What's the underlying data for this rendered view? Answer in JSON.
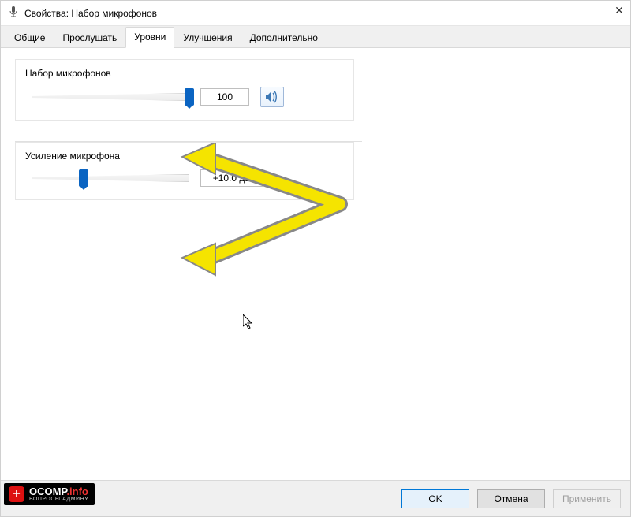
{
  "window": {
    "title": "Свойства: Набор микрофонов"
  },
  "tabs": {
    "general": "Общие",
    "listen": "Прослушать",
    "levels": "Уровни",
    "enhancements": "Улучшения",
    "advanced": "Дополнительно"
  },
  "groups": {
    "mic": {
      "label": "Набор микрофонов",
      "value": "100",
      "slider_percent": 100
    },
    "boost": {
      "label": "Усиление микрофона",
      "value": "+10.0 дБ",
      "slider_percent": 33
    }
  },
  "footer": {
    "ok": "OK",
    "cancel": "Отмена",
    "apply": "Применить"
  },
  "watermark": {
    "main": "OCOMP",
    "domain": ".info",
    "sub": "ВОПРОСЫ АДМИНУ"
  }
}
